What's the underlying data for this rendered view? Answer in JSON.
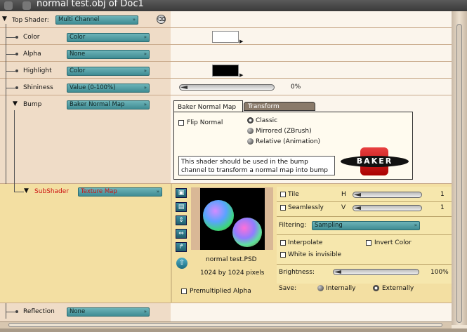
{
  "window": {
    "title": "normal test.obj of Doc1"
  },
  "tree": {
    "top_shader_label": "Top Shader:",
    "top_shader_value": "Multi Channel",
    "color_label": "Color",
    "color_value": "Color",
    "alpha_label": "Alpha",
    "alpha_value": "None",
    "highlight_label": "Highlight",
    "highlight_value": "Color",
    "shininess_label": "Shininess",
    "shininess_value": "Value (0-100%)",
    "shininess_percent": "0%",
    "bump_label": "Bump",
    "bump_value": "Baker Normal Map",
    "subshader_label": "SubShader",
    "subshader_value": "Texture Map",
    "reflection_label": "Reflection",
    "reflection_value": "None"
  },
  "colors": {
    "color_swatch": "#ffffff",
    "highlight_swatch": "#000000",
    "subshader_text": "#cc1111",
    "accent": "#4a9aa0"
  },
  "bump_panel": {
    "tabs": [
      "Baker Normal Map",
      "Transform"
    ],
    "flip_normal": "Flip Normal",
    "modes": [
      "Classic",
      "Mirrored (ZBrush)",
      "Relative (Animation)"
    ],
    "selected_mode": "Classic",
    "help_text_1": "This shader should be used in the bump",
    "help_text_2": "channel to transform a normal map into bump",
    "logo_text": "BAKER"
  },
  "texture_panel": {
    "file_name": "normal test.PSD",
    "dims": "1024 by 1024 pixels",
    "premult": "Premultiplied Alpha",
    "tile": "Tile",
    "h_label": "H",
    "h_value": "1",
    "seamlessly": "Seamlessly",
    "v_label": "V",
    "v_value": "1",
    "filtering_label": "Filtering:",
    "filtering_value": "Sampling",
    "interpolate": "Interpolate",
    "invert_color": "Invert Color",
    "white_invisible": "White is invisible",
    "brightness_label": "Brightness:",
    "brightness_value": "100%",
    "save_label": "Save:",
    "save_internally": "Internally",
    "save_externally": "Externally",
    "save_selected": "Externally"
  }
}
